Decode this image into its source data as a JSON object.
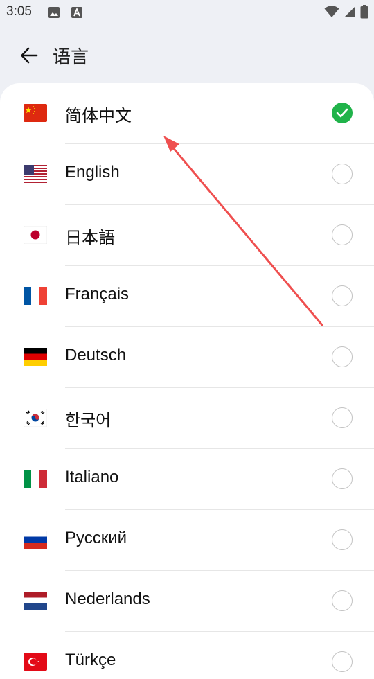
{
  "status_bar": {
    "time": "3:05",
    "left_icons": [
      "image-icon",
      "text-a-icon"
    ],
    "right_icons": [
      "wifi-icon",
      "signal-icon",
      "battery-icon"
    ]
  },
  "header": {
    "back_icon": "arrow-left-icon",
    "title": "语言"
  },
  "languages": [
    {
      "label": "简体中文",
      "flag": "cn",
      "selected": true
    },
    {
      "label": "English",
      "flag": "us",
      "selected": false
    },
    {
      "label": "日本語",
      "flag": "jp",
      "selected": false
    },
    {
      "label": "Français",
      "flag": "fr",
      "selected": false
    },
    {
      "label": "Deutsch",
      "flag": "de",
      "selected": false
    },
    {
      "label": "한국어",
      "flag": "kr",
      "selected": false
    },
    {
      "label": "Italiano",
      "flag": "it",
      "selected": false
    },
    {
      "label": "Русский",
      "flag": "ru",
      "selected": false
    },
    {
      "label": "Nederlands",
      "flag": "nl",
      "selected": false
    },
    {
      "label": "Türkçe",
      "flag": "tr",
      "selected": false
    }
  ],
  "colors": {
    "accent_check": "#20b34a",
    "annotation_arrow": "#ef4f4f",
    "background": "#eef0f5"
  }
}
